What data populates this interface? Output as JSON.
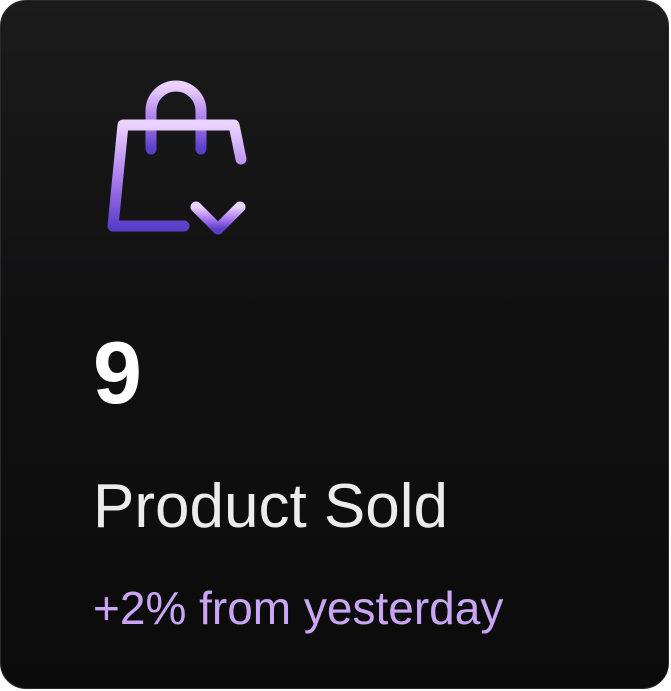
{
  "card": {
    "icon": "shopping-bag-download-icon",
    "value": "9",
    "label": "Product Sold",
    "change": "+2% from yesterday"
  },
  "colors": {
    "card_background": "#0f0f10",
    "value_text": "#ffffff",
    "label_text": "#ececec",
    "change_text": "#c9a6f4",
    "icon_gradient_top": "#e6c9ff",
    "icon_gradient_bottom": "#5a3fc9"
  }
}
